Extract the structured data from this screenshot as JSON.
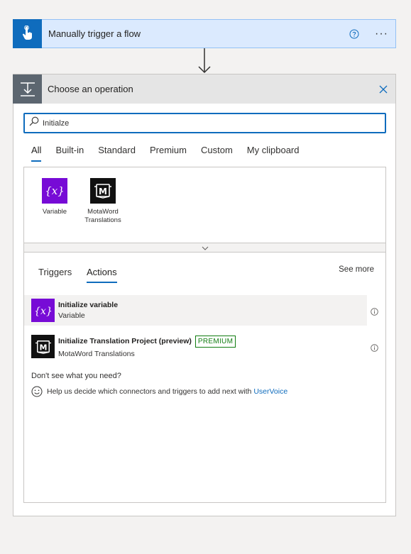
{
  "trigger": {
    "title": "Manually trigger a flow",
    "help_icon": "question-circle-icon",
    "more_icon": "more-dots-icon",
    "more_label": "···"
  },
  "operation": {
    "title": "Choose an operation",
    "close_icon": "close-icon",
    "search_value": "Initialze",
    "filter_tabs": [
      "All",
      "Built-in",
      "Standard",
      "Premium",
      "Custom",
      "My clipboard"
    ],
    "active_filter": "All"
  },
  "connectors": [
    {
      "label_line1": "Variable",
      "label_line2": "",
      "icon": "variable-icon"
    },
    {
      "label_line1": "MotaWord",
      "label_line2": "Translations",
      "icon": "motaword-icon"
    }
  ],
  "action_tabs": {
    "triggers": "Triggers",
    "actions": "Actions",
    "active": "Actions",
    "see_more": "See more"
  },
  "actions": [
    {
      "name": "Initialize variable",
      "connector": "Variable",
      "premium": ""
    },
    {
      "name": "Initialize Translation Project (preview)",
      "connector": "MotaWord Translations",
      "premium": "PREMIUM"
    }
  ],
  "help": {
    "dont_see": "Don't see what you need?",
    "text": "Help us decide which connectors and triggers to add next with",
    "link": "UserVoice"
  },
  "colors": {
    "accent": "#0f6cbd",
    "variable_purple": "#770bd6",
    "premium_green": "#107c10"
  }
}
